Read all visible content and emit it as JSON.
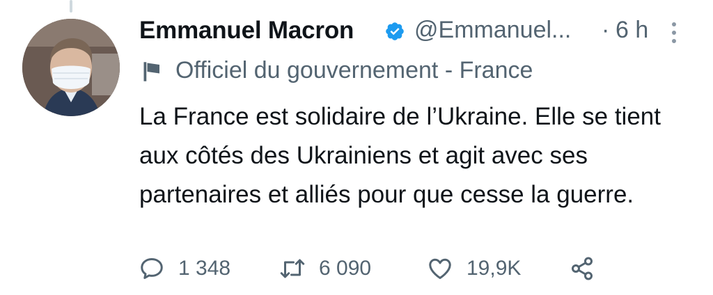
{
  "tweet": {
    "author": {
      "name": "Emmanuel Macron",
      "handle": "@Emmanuel...",
      "verified": true
    },
    "time_separator": "·",
    "time": "6 h",
    "label": "Officiel du gouvernement - France",
    "text": "La France est solidaire de l’Ukraine. Elle se tient aux côtés des Ukrainiens et agit avec ses partenaires et alliés pour que cesse la guerre.",
    "actions": {
      "replies": "1 348",
      "retweets": "6 090",
      "likes": "19,9K"
    }
  },
  "colors": {
    "verified_blue": "#1d9bf0",
    "text": "#0f1419",
    "secondary_text": "#536471"
  },
  "icons": {
    "verified": "verified-badge-icon",
    "more": "more-vertical-icon",
    "label": "flag-icon",
    "reply": "reply-icon",
    "retweet": "retweet-icon",
    "like": "heart-icon",
    "share": "share-icon"
  }
}
